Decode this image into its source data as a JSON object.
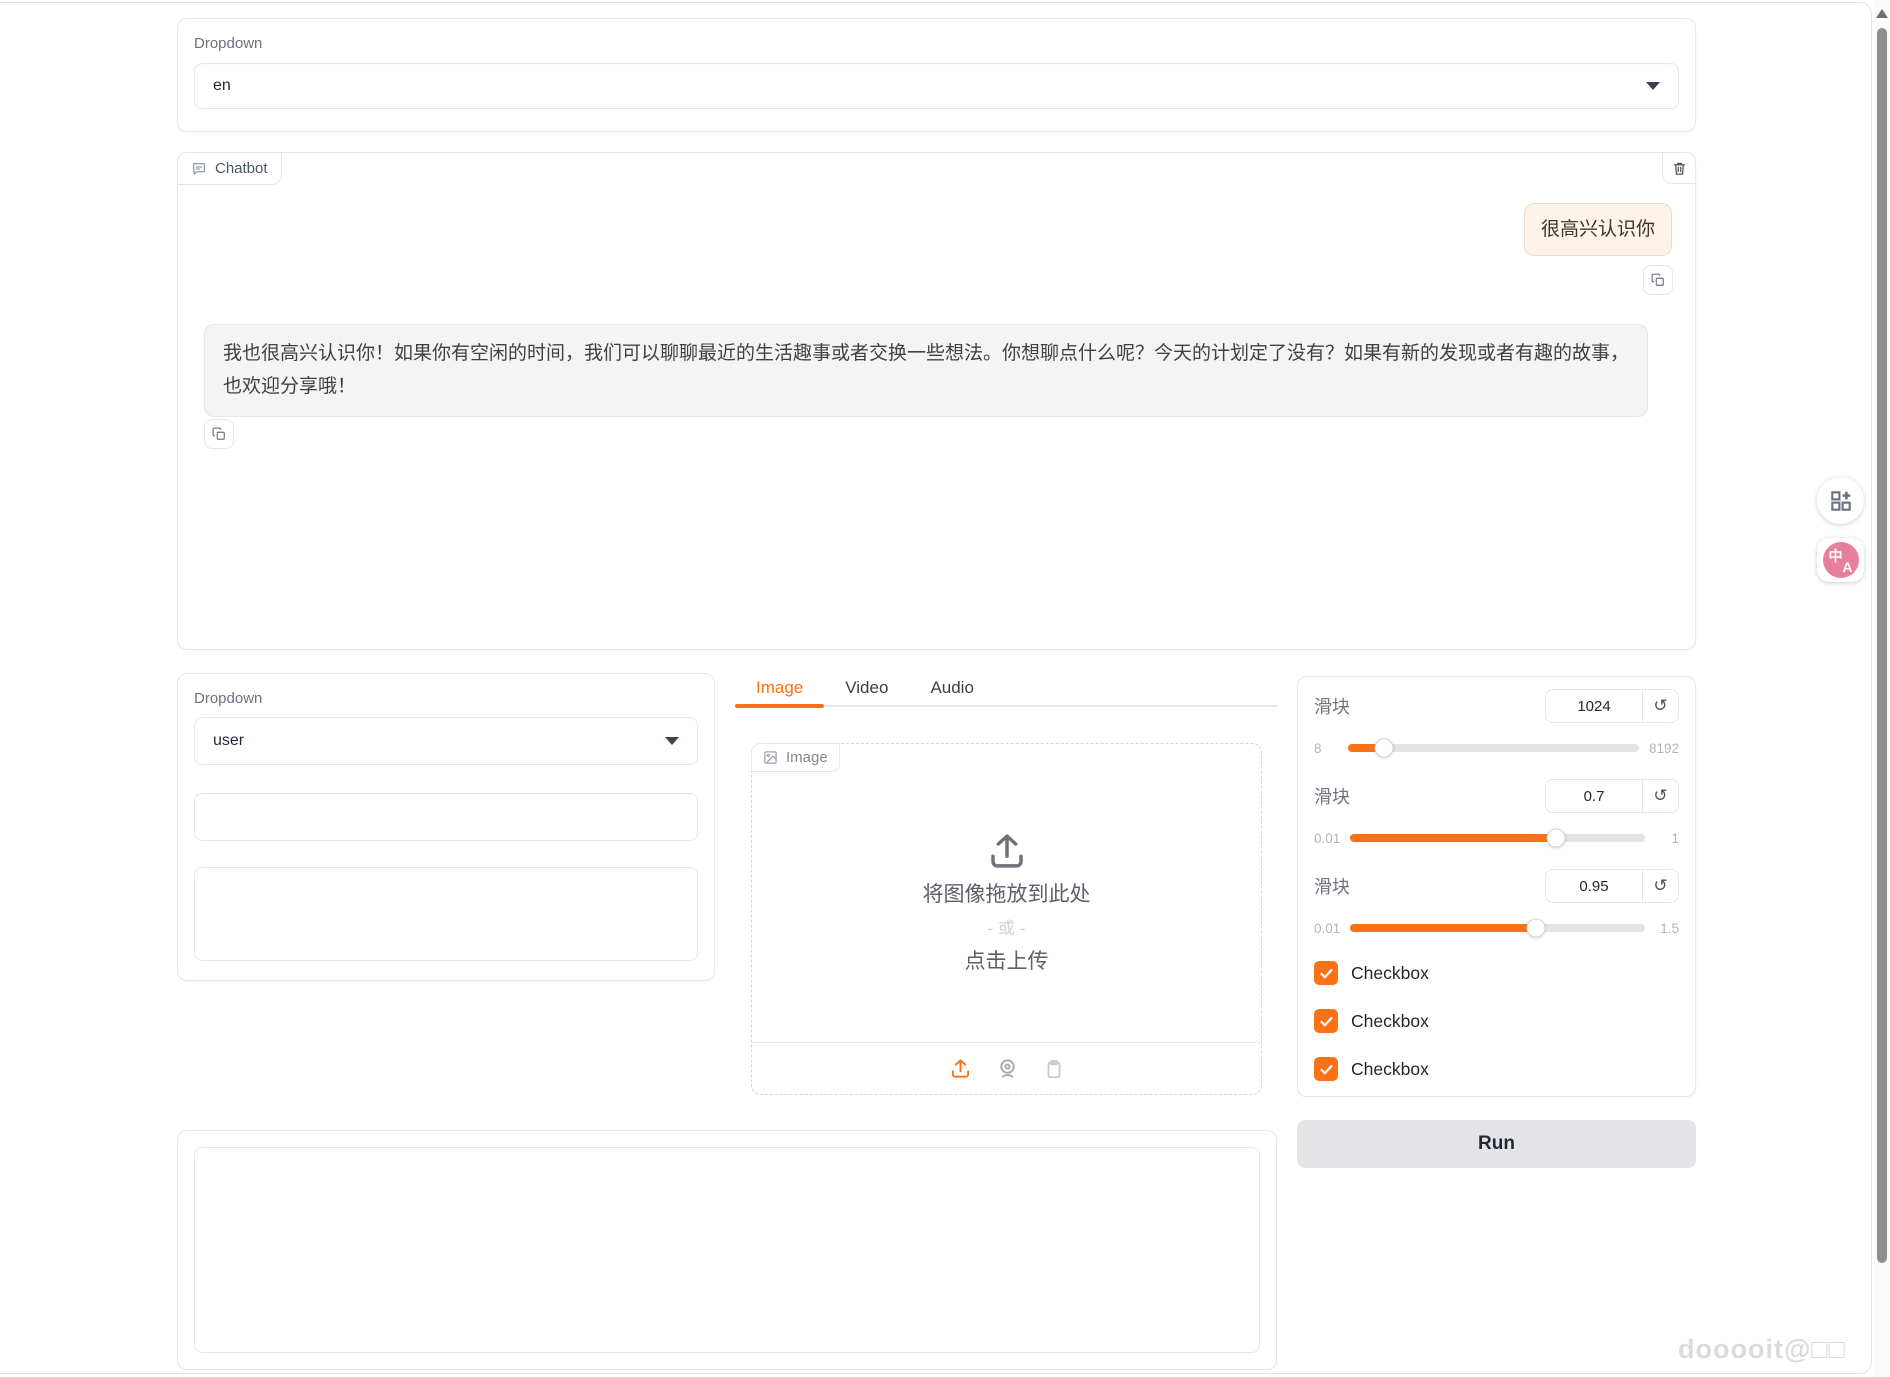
{
  "colors": {
    "accent": "#f97316",
    "user_bubble_bg": "#fdf3e8",
    "user_bubble_border": "#eedcc0"
  },
  "language_dropdown": {
    "label": "Dropdown",
    "value": "en"
  },
  "chatbot": {
    "label": "Chatbot",
    "user_message": "很高兴认识你",
    "bot_message": "我也很高兴认识你！如果你有空闲的时间，我们可以聊聊最近的生活趣事或者交换一些想法。你想聊点什么呢？今天的计划定了没有？如果有新的发现或者有趣的故事，也欢迎分享哦！"
  },
  "role_panel": {
    "dropdown_label": "Dropdown",
    "dropdown_value": "user",
    "textbox1_value": "",
    "textbox2_value": ""
  },
  "tabs": {
    "items": [
      "Image",
      "Video",
      "Audio"
    ],
    "active": "Image"
  },
  "upload": {
    "label": "Image",
    "drop_text": "将图像拖放到此处",
    "or_text": "- 或 -",
    "click_text": "点击上传"
  },
  "sliders": [
    {
      "label": "滑块",
      "value": "1024",
      "min": "8",
      "max": "8192",
      "percent": 12.4
    },
    {
      "label": "滑块",
      "value": "0.7",
      "min": "0.01",
      "max": "1",
      "percent": 69.7
    },
    {
      "label": "滑块",
      "value": "0.95",
      "min": "0.01",
      "max": "1.5",
      "percent": 63.1
    }
  ],
  "checkboxes": [
    {
      "label": "Checkbox",
      "checked": true
    },
    {
      "label": "Checkbox",
      "checked": true
    },
    {
      "label": "Checkbox",
      "checked": true
    }
  ],
  "run_button": {
    "label": "Run"
  },
  "watermark": "dooooit@□□",
  "icons": {
    "reset": "↺"
  }
}
